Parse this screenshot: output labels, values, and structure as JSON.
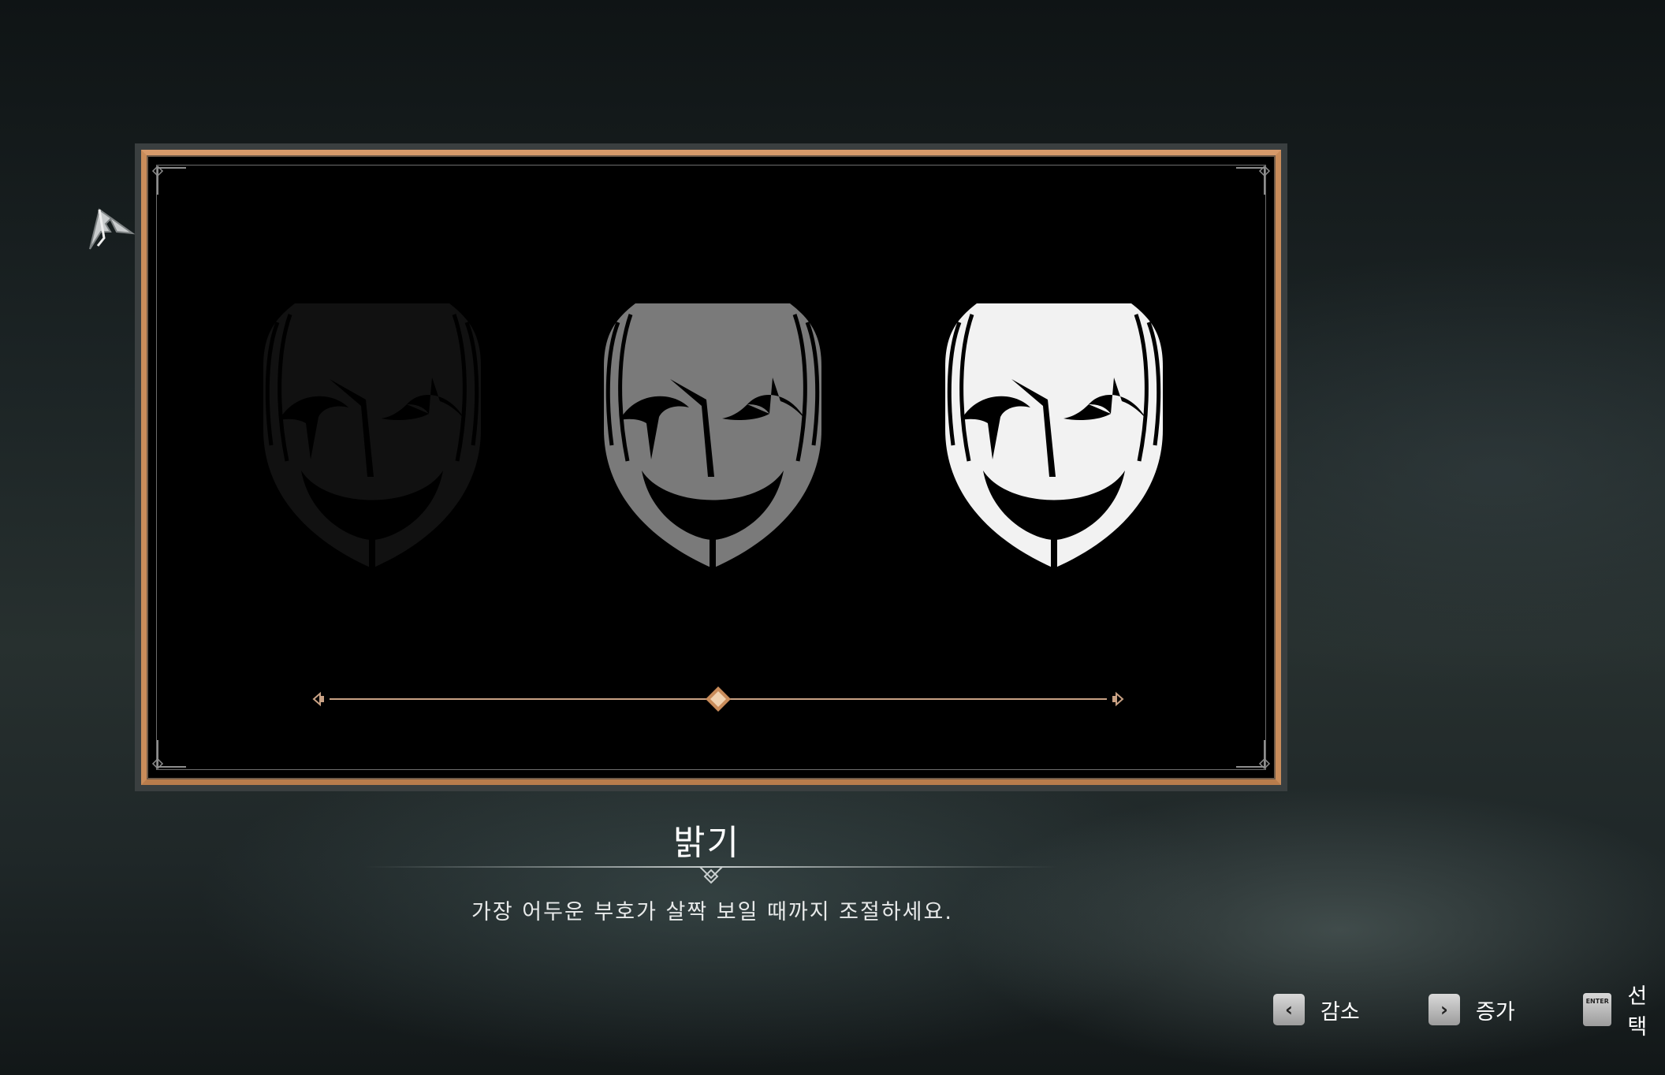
{
  "screen": {
    "title": "밝기",
    "description": "가장 어두운 부호가 살짝 보일 때까지 조절하세요."
  },
  "brightness_slider": {
    "value_fraction": 0.5
  },
  "masks": [
    {
      "name": "dark-mask",
      "fill": "#111111"
    },
    {
      "name": "mid-mask",
      "fill": "#7a7a7a"
    },
    {
      "name": "bright-mask",
      "fill": "#f2f2f2"
    }
  ],
  "hints": [
    {
      "key": "‹",
      "label": "감소"
    },
    {
      "key": "›",
      "label": "증가"
    },
    {
      "key": "ENTER",
      "label": "선택"
    }
  ],
  "colors": {
    "accent_gold": "#c98c5a",
    "slider_track": "#c8a184"
  }
}
